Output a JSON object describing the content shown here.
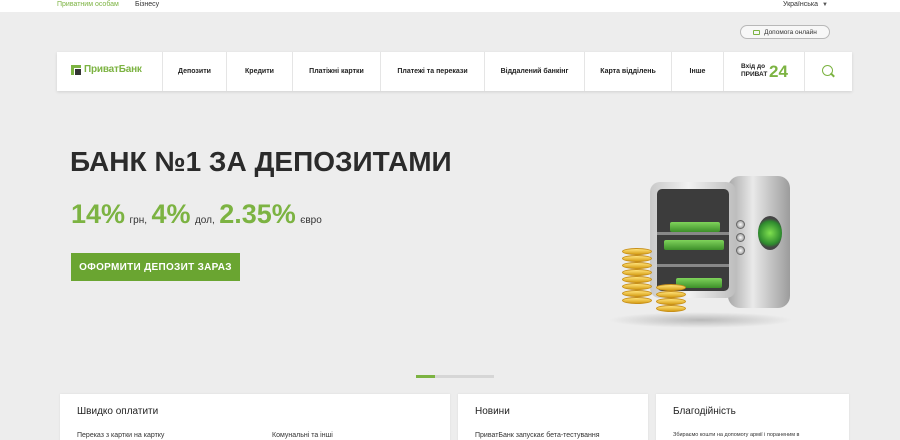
{
  "topbar": {
    "segments": [
      "Приватним особам",
      "Бізнесу"
    ],
    "language": "Українська"
  },
  "help": {
    "label": "Допомога онлайн"
  },
  "nav": {
    "logo_text": "ПриватБанк",
    "items": [
      "Депозити",
      "Кредити",
      "Платіжні картки",
      "Платежі та перекази",
      "Віддалений банкінг",
      "Карта відділень",
      "Інше"
    ],
    "login_line1": "Вхід до",
    "login_line2": "ПРИВАТ",
    "login_num": "24"
  },
  "hero": {
    "title": "БАНК №1 ЗА ДЕПОЗИТАМИ",
    "rates": [
      {
        "value": "14%",
        "unit": "грн,"
      },
      {
        "value": "4%",
        "unit": "дол,"
      },
      {
        "value": "2.35%",
        "unit": "євро"
      }
    ],
    "cta": "ОФОРМИТИ ДЕПОЗИТ ЗАРАЗ"
  },
  "cards": {
    "quick_pay": {
      "title": "Швидко оплатити",
      "item1": "Переказ з картки на картку",
      "item2": "Комунальні та інші"
    },
    "news": {
      "title": "Новини",
      "item1": "ПриватБанк запускає бета-тестування"
    },
    "charity": {
      "title": "Благодійність",
      "item1": "Збираємо кошти на допомогу армії і пораненим в"
    }
  }
}
